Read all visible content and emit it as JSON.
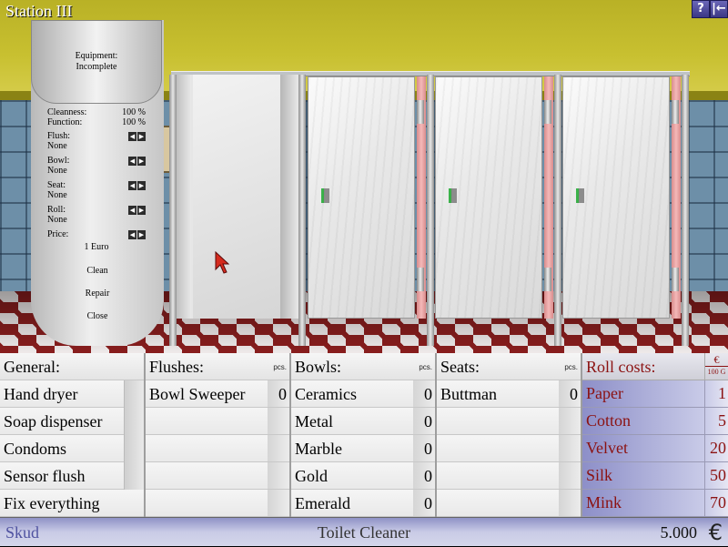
{
  "window": {
    "title": "Station III",
    "help_label": "?",
    "exit_label": "|←"
  },
  "info_panel": {
    "equipment_label": "Equipment:",
    "equipment_status": "Incomplete",
    "cleanness_label": "Cleanness:",
    "cleanness_value": "100 %",
    "function_label": "Function:",
    "function_value": "100 %",
    "items": [
      {
        "label": "Flush:",
        "value": "None"
      },
      {
        "label": "Bowl:",
        "value": "None"
      },
      {
        "label": "Seat:",
        "value": "None"
      },
      {
        "label": "Roll:",
        "value": "None"
      },
      {
        "label": "Price:",
        "value": ""
      }
    ],
    "price_value": "1 Euro",
    "clean_label": "Clean",
    "repair_label": "Repair",
    "close_label": "Close",
    "arrow_left": "◀",
    "arrow_right": "▶"
  },
  "shop": {
    "general": {
      "header": "General:",
      "items": [
        "Hand dryer",
        "Soap dispenser",
        "Condoms",
        "Sensor flush",
        "Fix everything"
      ]
    },
    "flushes": {
      "header": "Flushes:",
      "pcs_label": "pcs.",
      "items": [
        {
          "name": "Bowl Sweeper",
          "count": "0"
        }
      ]
    },
    "bowls": {
      "header": "Bowls:",
      "pcs_label": "pcs.",
      "items": [
        {
          "name": "Ceramics",
          "count": "0"
        },
        {
          "name": "Metal",
          "count": "0"
        },
        {
          "name": "Marble",
          "count": "0"
        },
        {
          "name": "Gold",
          "count": "0"
        },
        {
          "name": "Emerald",
          "count": "0"
        }
      ]
    },
    "seats": {
      "header": "Seats:",
      "pcs_label": "pcs.",
      "items": [
        {
          "name": "Buttman",
          "count": "0"
        }
      ]
    },
    "rolls": {
      "header": "Roll costs:",
      "currency_symbol": "€",
      "currency_unit": "100 G",
      "items": [
        {
          "name": "Paper",
          "cost": "1"
        },
        {
          "name": "Cotton",
          "cost": "5"
        },
        {
          "name": "Velvet",
          "cost": "20"
        },
        {
          "name": "Silk",
          "cost": "50"
        },
        {
          "name": "Mink",
          "cost": "70"
        }
      ]
    }
  },
  "status_bar": {
    "player": "Skud",
    "rank": "Toilet Cleaner",
    "money": "5.000",
    "currency_symbol": "€"
  },
  "colors": {
    "roll_text": "#8b1212",
    "status_bar": "#c9cbe6",
    "ceiling": "#c8c030",
    "floor_dark": "#8a1e1e"
  }
}
